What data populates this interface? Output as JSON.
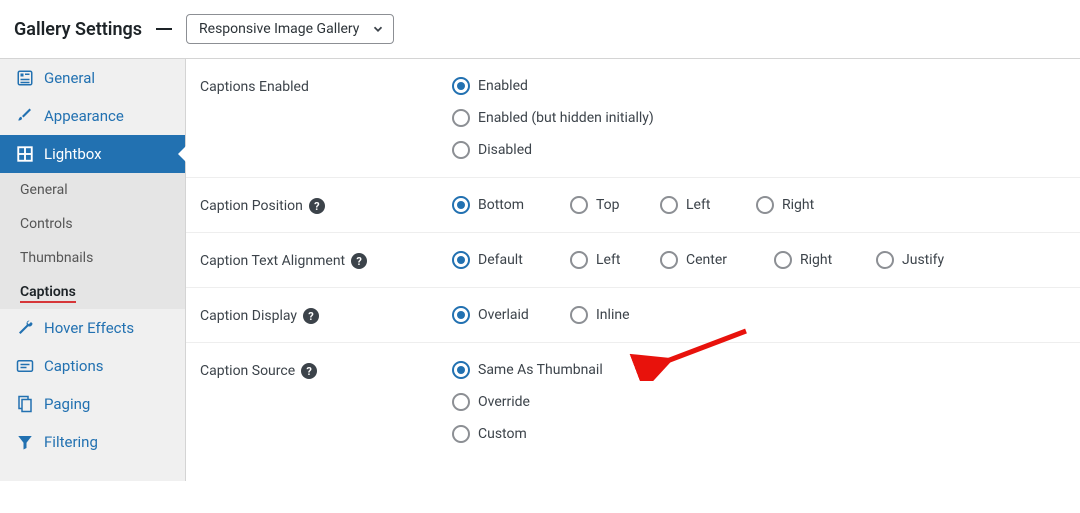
{
  "header": {
    "title": "Gallery Settings",
    "dropdown_value": "Responsive Image Gallery"
  },
  "sidebar": {
    "items": [
      {
        "label": "General",
        "icon": "panel-icon"
      },
      {
        "label": "Appearance",
        "icon": "brush-icon"
      },
      {
        "label": "Lightbox",
        "icon": "grid-icon"
      },
      {
        "label": "Hover Effects",
        "icon": "wrench-icon"
      },
      {
        "label": "Captions",
        "icon": "caption-icon"
      },
      {
        "label": "Paging",
        "icon": "pages-icon"
      },
      {
        "label": "Filtering",
        "icon": "filter-icon"
      }
    ],
    "sub": [
      {
        "label": "General"
      },
      {
        "label": "Controls"
      },
      {
        "label": "Thumbnails"
      },
      {
        "label": "Captions"
      }
    ]
  },
  "settings": {
    "captions_enabled": {
      "label": "Captions Enabled",
      "options": [
        "Enabled",
        "Enabled (but hidden initially)",
        "Disabled"
      ],
      "selected": 0
    },
    "caption_position": {
      "label": "Caption Position",
      "options": [
        "Bottom",
        "Top",
        "Left",
        "Right"
      ],
      "selected": 0
    },
    "caption_text_alignment": {
      "label": "Caption Text Alignment",
      "options": [
        "Default",
        "Left",
        "Center",
        "Right",
        "Justify"
      ],
      "selected": 0
    },
    "caption_display": {
      "label": "Caption Display",
      "options": [
        "Overlaid",
        "Inline"
      ],
      "selected": 0
    },
    "caption_source": {
      "label": "Caption Source",
      "options": [
        "Same As Thumbnail",
        "Override",
        "Custom"
      ],
      "selected": 0
    }
  }
}
